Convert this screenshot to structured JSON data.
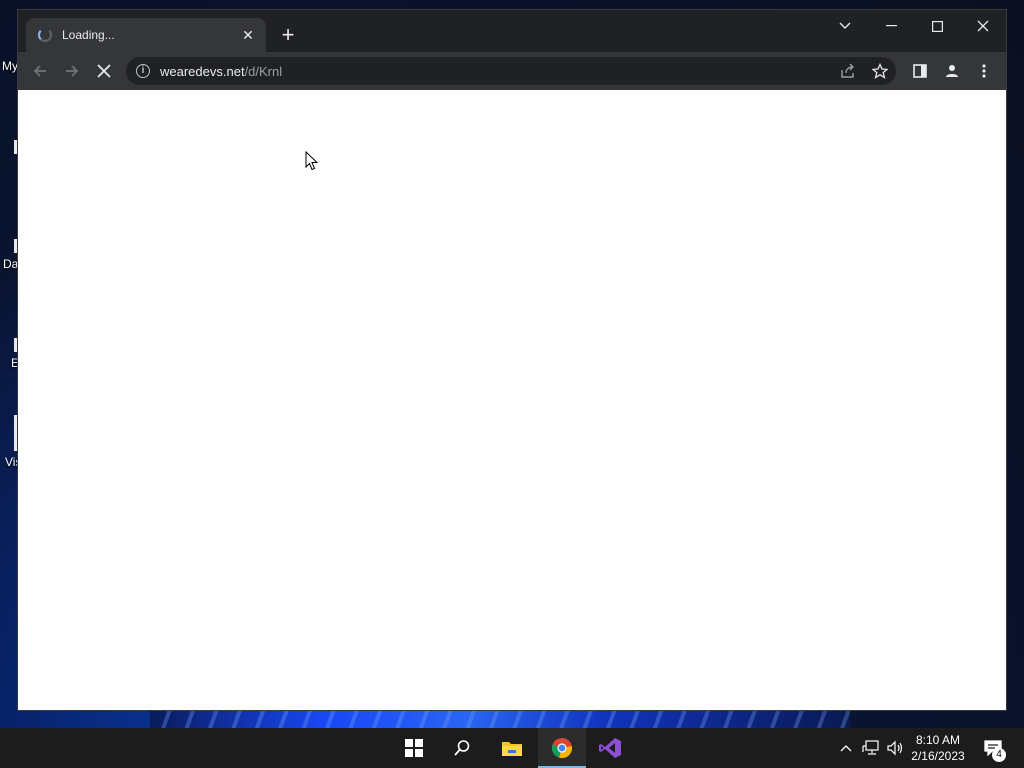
{
  "desktop": {
    "labels": [
      "My",
      "Da",
      "E",
      "Vis"
    ]
  },
  "browser": {
    "tab": {
      "title": "Loading...",
      "close_label": "✕"
    },
    "new_tab_label": "+",
    "address": {
      "domain": "wearedevs.net",
      "path": "/d/Krnl"
    },
    "state": "loading",
    "accent": "#8ab4f8"
  },
  "taskbar": {
    "apps": [
      "start-icon",
      "search-icon",
      "file-explorer-icon",
      "chrome-icon",
      "visual-studio-icon"
    ],
    "active_app": "chrome-icon",
    "clock": {
      "time": "8:10 AM",
      "date": "2/16/2023"
    },
    "notification_count": "4"
  }
}
